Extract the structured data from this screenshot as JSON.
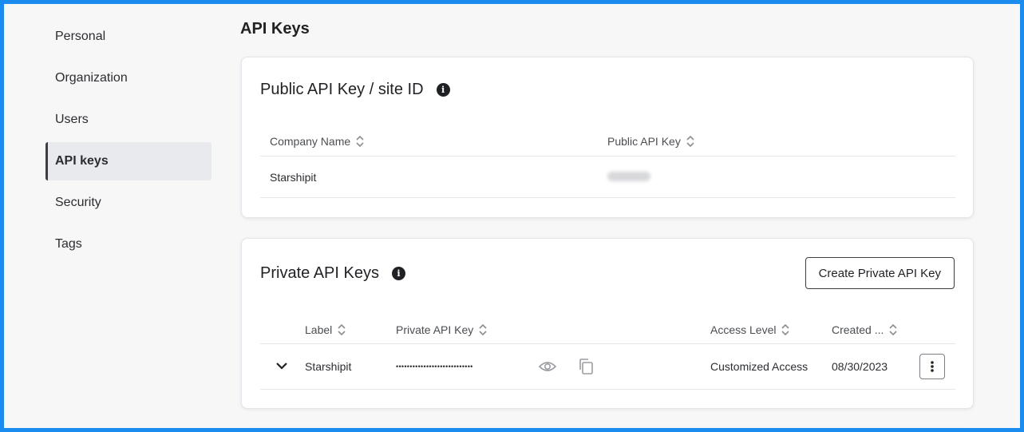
{
  "sidebar": {
    "items": [
      {
        "label": "Personal"
      },
      {
        "label": "Organization"
      },
      {
        "label": "Users"
      },
      {
        "label": "API keys",
        "active": true
      },
      {
        "label": "Security"
      },
      {
        "label": "Tags"
      }
    ]
  },
  "page": {
    "title": "API Keys"
  },
  "public_card": {
    "title": "Public API Key / site ID",
    "columns": [
      "Company Name",
      "Public API Key"
    ],
    "row": {
      "company_name": "Starshipit",
      "public_api_key": ""
    }
  },
  "private_card": {
    "title": "Private API Keys",
    "create_button": "Create Private API Key",
    "columns": [
      "Label",
      "Private API Key",
      "Access Level",
      "Created ..."
    ],
    "row": {
      "label": "Starshipit",
      "masked_key": "••••••••••••••••••••••••••••",
      "access_level": "Customized Access",
      "created": "08/30/2023"
    }
  },
  "colors": {
    "frame": "#1a8cf0",
    "accent_active": "#3b3e42"
  },
  "icons": [
    "info-icon",
    "sort-icon",
    "chevron-down-icon",
    "eye-icon",
    "copy-icon",
    "more-vertical-icon"
  ]
}
